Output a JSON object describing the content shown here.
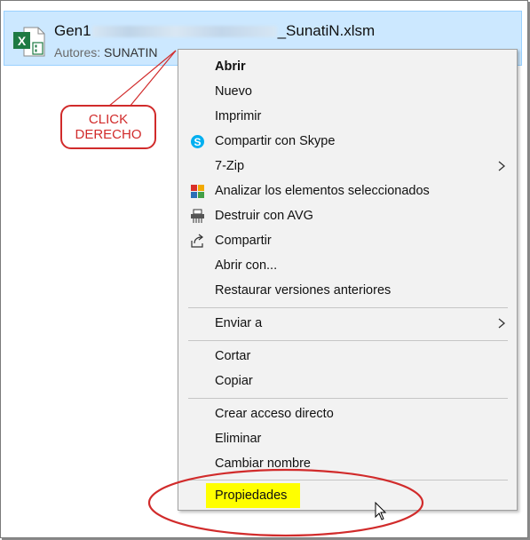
{
  "file": {
    "name_prefix": "Gen1",
    "name_suffix": "_SunatiN.xlsm",
    "author_label": "Autores:",
    "author_value": "SUNATIN",
    "icon": "excel-icon"
  },
  "callout": {
    "line1": "CLICK",
    "line2": "DERECHO",
    "color": "#d12b2b"
  },
  "menu": {
    "items": [
      {
        "label": "Abrir",
        "icon": ""
      },
      {
        "label": "Nuevo",
        "icon": ""
      },
      {
        "label": "Imprimir",
        "icon": ""
      },
      {
        "label": "Compartir con Skype",
        "icon": "skype-icon"
      },
      {
        "label": "7-Zip",
        "icon": "",
        "submenu": true
      },
      {
        "label": "Analizar los elementos seleccionados",
        "icon": "avg-icon"
      },
      {
        "label": "Destruir con AVG",
        "icon": "shredder-icon"
      },
      {
        "label": "Compartir",
        "icon": "share-icon"
      },
      {
        "label": "Abrir con...",
        "icon": ""
      },
      {
        "label": "Restaurar versiones anteriores",
        "icon": ""
      },
      {
        "label": "Enviar a",
        "icon": "",
        "submenu": true
      },
      {
        "label": "Cortar",
        "icon": ""
      },
      {
        "label": "Copiar",
        "icon": ""
      },
      {
        "label": "Crear acceso directo",
        "icon": ""
      },
      {
        "label": "Eliminar",
        "icon": ""
      },
      {
        "label": "Cambiar nombre",
        "icon": ""
      },
      {
        "label": "Propiedades",
        "icon": ""
      }
    ],
    "highlight_color": "#ffff00",
    "annotation_color": "#d12b2b"
  }
}
